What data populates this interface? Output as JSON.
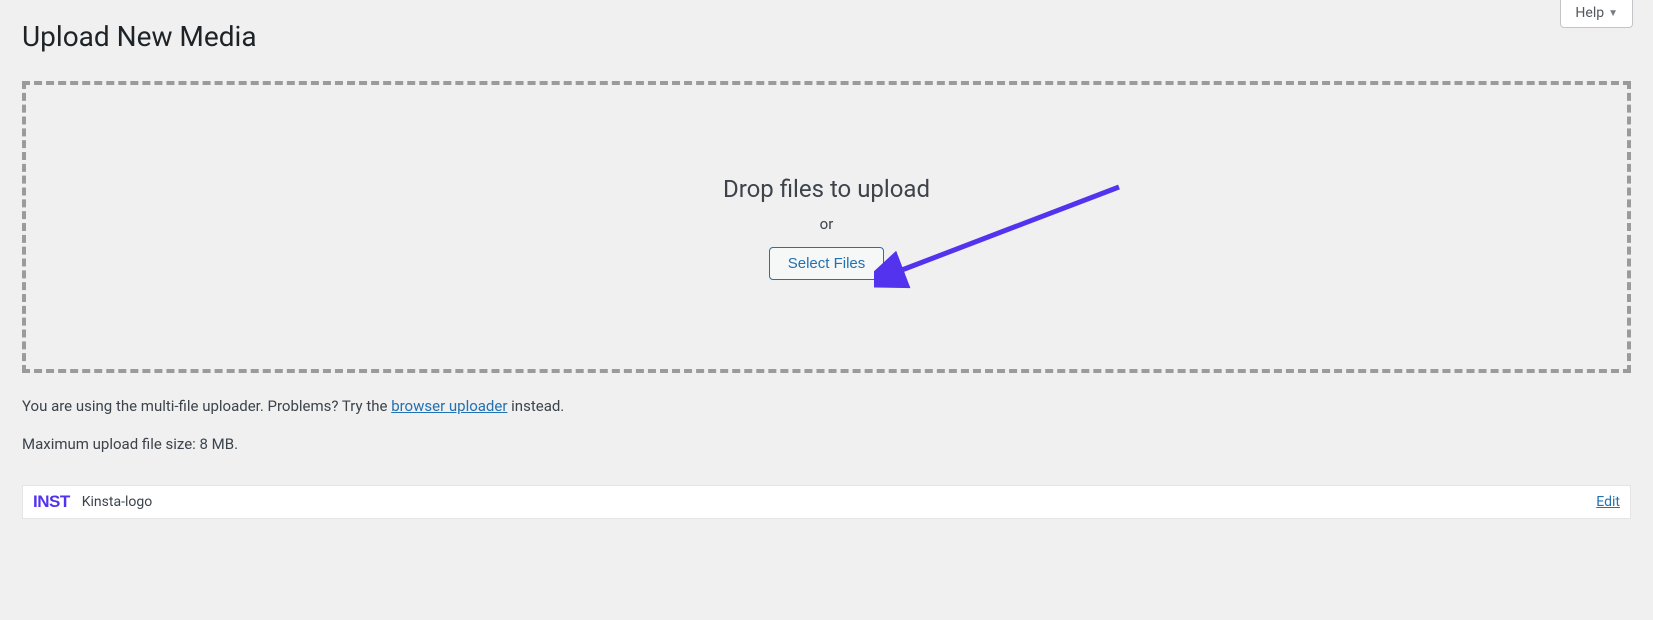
{
  "help": {
    "label": "Help"
  },
  "page": {
    "title": "Upload New Media"
  },
  "uploader": {
    "drop_heading": "Drop files to upload",
    "or_label": "or",
    "select_button": "Select Files"
  },
  "info": {
    "prefix": "You are using the multi-file uploader. Problems? Try the ",
    "link_text": "browser uploader",
    "suffix": " instead."
  },
  "max_size": "Maximum upload file size: 8 MB.",
  "media_item": {
    "thumb_text": "INST",
    "filename": "Kinsta-logo",
    "edit_label": "Edit"
  }
}
